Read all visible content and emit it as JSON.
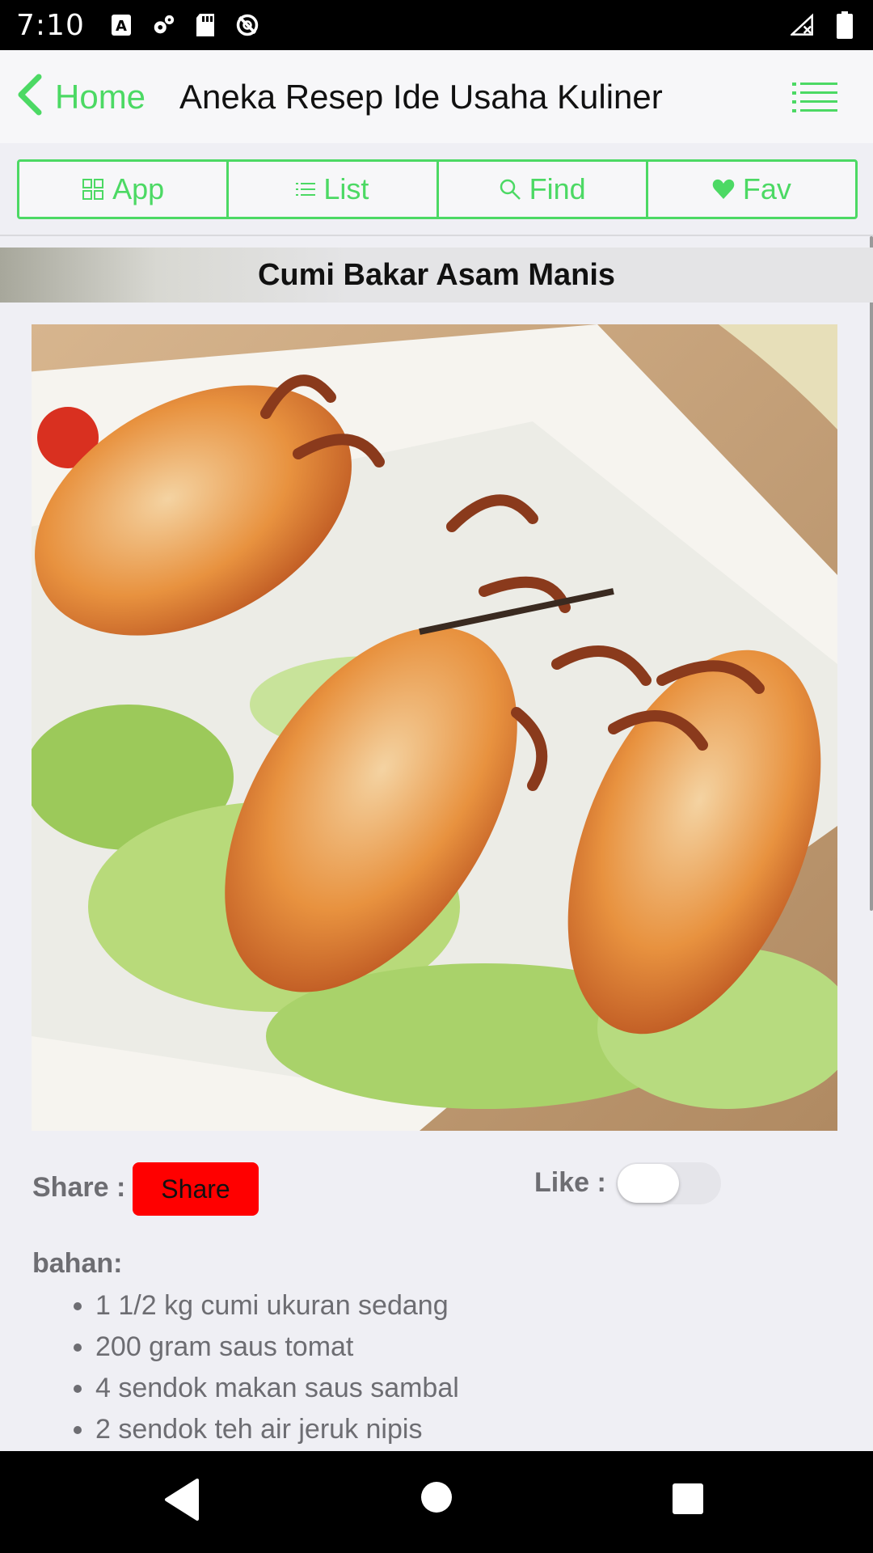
{
  "status_bar": {
    "time": "7:10",
    "left_icons": [
      "font-a-icon",
      "settings-icon",
      "sd-card-icon",
      "no-sync-icon"
    ],
    "right_icons": [
      "signal-no-data-icon",
      "battery-icon"
    ]
  },
  "header": {
    "back_label": "Home",
    "title": "Aneka Resep Ide Usaha Kuliner",
    "menu_icon": "list-menu-icon",
    "accent_color": "#4cd964"
  },
  "segments": [
    {
      "label": "App",
      "icon": "grid-icon"
    },
    {
      "label": "List",
      "icon": "list-icon"
    },
    {
      "label": "Find",
      "icon": "search-icon"
    },
    {
      "label": "Fav",
      "icon": "heart-icon"
    }
  ],
  "recipe": {
    "title": "Cumi Bakar Asam Manis",
    "image_subject": "grilled squid on lettuce",
    "share_label": "Share :",
    "share_button": "Share",
    "like_label": "Like :",
    "like_on": false,
    "ingredients_heading": "bahan:",
    "ingredients": [
      "1 1/2 kg cumi ukuran sedang",
      "200 gram saus tomat",
      "4 sendok makan saus sambal",
      "2 sendok teh air jeruk nipis"
    ]
  },
  "system_nav": {
    "icons": [
      "back-triangle-icon",
      "home-circle-icon",
      "recents-square-icon"
    ]
  }
}
